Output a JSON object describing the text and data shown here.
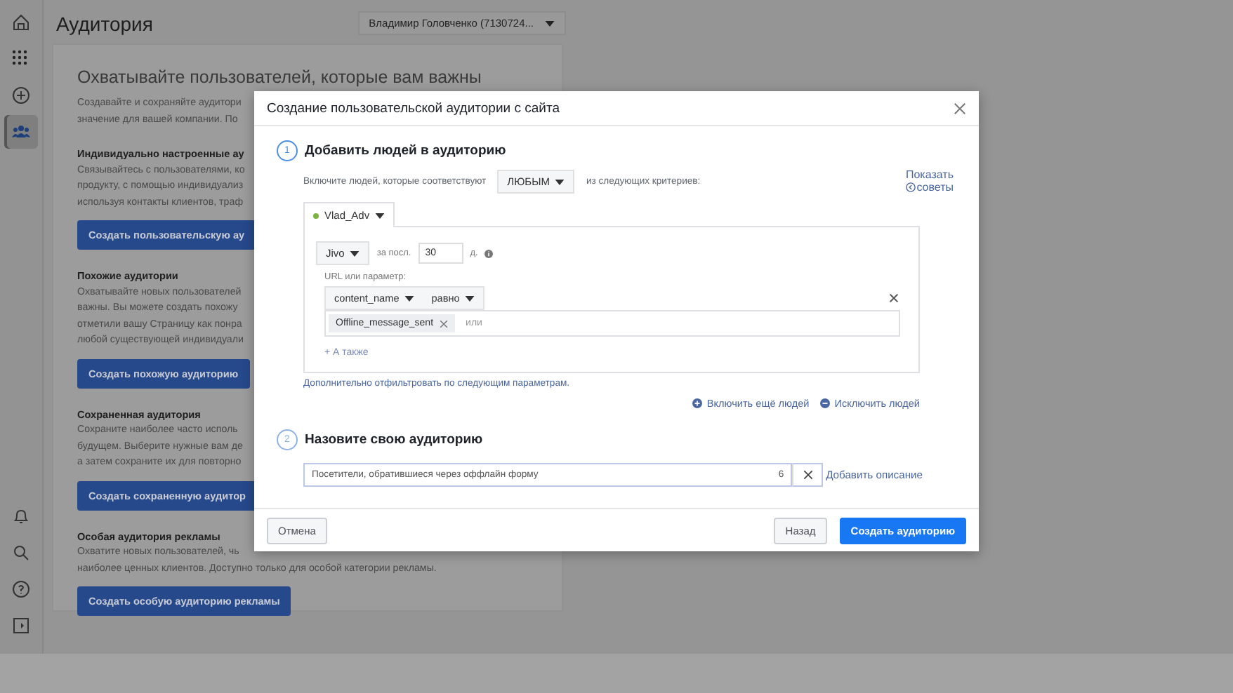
{
  "sidebar": {
    "top_items": [
      {
        "kind": "home",
        "selected": false
      },
      {
        "kind": "apps",
        "selected": false
      },
      {
        "kind": "create",
        "selected": false
      },
      {
        "kind": "audiences",
        "selected": true
      }
    ],
    "bottom_items": [
      {
        "kind": "notifications",
        "selected": false
      },
      {
        "kind": "search",
        "selected": false
      },
      {
        "kind": "help",
        "selected": false
      },
      {
        "kind": "panel",
        "selected": false
      }
    ]
  },
  "page": {
    "title": "Аудитория",
    "account": "Владимир Головченко (7130724..."
  },
  "card": {
    "heading": "Охватывайте пользователей, которые вам важны",
    "intro": [
      "Создавайте и сохраняйте аудитори",
      "значение для вашей компании. По"
    ],
    "sections": [
      {
        "title": "Индивидуально настроенные ау",
        "lines": [
          "Связывайтесь с пользователями, ко",
          "продукту, с помощью индивидуализ",
          "используя контакты клиентов, траф"
        ],
        "button": "Создать пользовательскую ау"
      },
      {
        "title": "Похожие аудитории",
        "lines": [
          "Охватывайте новых пользователей",
          "важны. Вы можете создать похожу",
          "отметили вашу Страницу как понра",
          "любой существующей индивидуали"
        ],
        "button": "Создать похожую аудиторию"
      },
      {
        "title": "Сохраненная аудитория",
        "lines": [
          "Сохраните наиболее часто исполь",
          "будущем. Выберите нужные вам де",
          "а затем сохраните их для повторно"
        ],
        "button": "Создать сохраненную аудитор"
      },
      {
        "title": "Особая аудитория рекламы",
        "lines": [
          "Охватите новых пользователей, чь",
          "наиболее ценных клиентов. Доступно только для особой категории рекламы."
        ],
        "button": "Создать особую аудиторию рекламы"
      }
    ]
  },
  "dialog": {
    "title": "Создание пользовательской аудитории с сайта",
    "step1": {
      "number": "1",
      "title": "Добавить людей в аудиторию",
      "tips": [
        "Показать",
        "советы"
      ],
      "include_prefix": "Включите людей, которые соответствуют",
      "match": "ЛЮБЫМ",
      "include_suffix": "из следующих критериев:",
      "source": "Vlad_Adv",
      "rule": {
        "event": "Jivo",
        "period_label": "за посл.",
        "days": "30",
        "days_unit": "д.",
        "url_label": "URL или параметр:",
        "parameter": "content_name",
        "operator": "равно",
        "tokens": [
          "Offline_message_sent"
        ],
        "token_placeholder": "или",
        "add_more": "+ А также"
      },
      "filter_link": "Дополнительно отфильтровать по следующим параметрам.",
      "actions": [
        {
          "kind": "include",
          "label": "Включить ещё людей"
        },
        {
          "kind": "exclude",
          "label": "Исключить людей"
        }
      ]
    },
    "step2": {
      "number": "2",
      "title": "Назовите свою аудиторию",
      "name": "Посетители, обратившиеся через оффлайн форму",
      "counter": "6",
      "add_description": "Добавить описание"
    },
    "buttons": {
      "cancel": "Отмена",
      "back": "Назад",
      "create": "Создать аудиторию"
    }
  }
}
